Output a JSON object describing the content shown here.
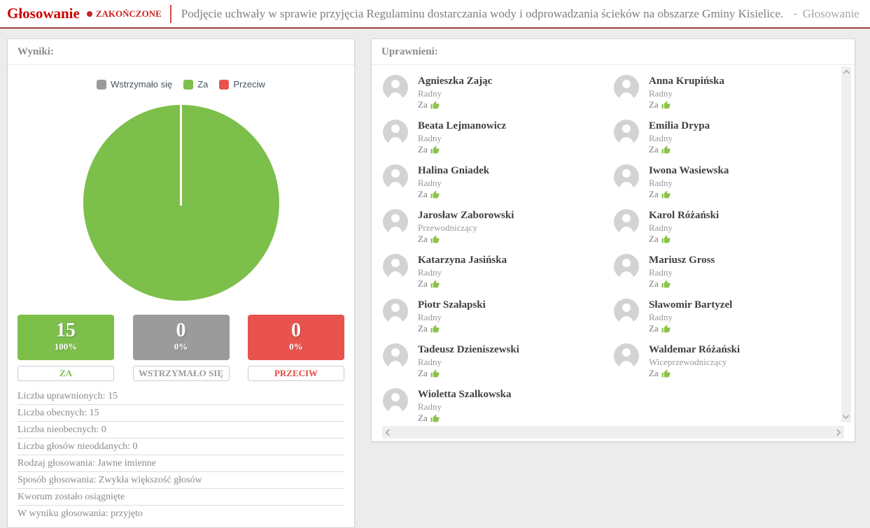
{
  "header": {
    "app_title": "Głosowanie",
    "status": "ZAKOŃCZONE",
    "doc_title": "Podjęcie uchwały w sprawie przyjęcia Regulaminu dostarczania wody i odprowadzania ścieków na obszarze Gminy Kisielice.",
    "crumb_dash": "-",
    "breadcrumb": "Głosowanie"
  },
  "chart_data": {
    "type": "pie",
    "labels": [
      "Wstrzymało się",
      "Za",
      "Przeciw"
    ],
    "values": [
      0,
      15,
      0
    ],
    "percentages": [
      0,
      100,
      0
    ],
    "colors": [
      "#9b9b9b",
      "#7cbf4a",
      "#e8534e"
    ],
    "legend_position": "top"
  },
  "results": {
    "panel_title": "Wyniki:",
    "legend": [
      {
        "label": "Wstrzymało się",
        "color": "#9b9b9b"
      },
      {
        "label": "Za",
        "color": "#7cbf4a"
      },
      {
        "label": "Przeciw",
        "color": "#e8534e"
      }
    ],
    "boxes": [
      {
        "count": "15",
        "percent": "100%",
        "label": "ZA",
        "color": "#7cbf4a"
      },
      {
        "count": "0",
        "percent": "0%",
        "label": "WSTRZYMAŁO SIĘ",
        "color": "#9b9b9b"
      },
      {
        "count": "0",
        "percent": "0%",
        "label": "PRZECIW",
        "color": "#e8534e"
      }
    ],
    "stats": [
      "Liczba uprawnionych: 15",
      "Liczba obecnych: 15",
      "Liczba nieobecnych: 0",
      "Liczba głosów nieoddanych: 0",
      "Rodzaj głosowania: Jawne imienne",
      "Sposób głosowania: Zwykła większość głosów",
      "Kworum zostało osiągnięte",
      "W wyniku głosowania: przyjęto"
    ]
  },
  "members": {
    "panel_title": "Uprawnieni:",
    "items": [
      {
        "name": "Agnieszka Zając",
        "role": "Radny",
        "vote": "Za"
      },
      {
        "name": "Anna Krupińska",
        "role": "Radny",
        "vote": "Za"
      },
      {
        "name": "Beata Lejmanowicz",
        "role": "Radny",
        "vote": "Za"
      },
      {
        "name": "Emilia Drypa",
        "role": "Radny",
        "vote": "Za"
      },
      {
        "name": "Halina Gniadek",
        "role": "Radny",
        "vote": "Za"
      },
      {
        "name": "Iwona Wasiewska",
        "role": "Radny",
        "vote": "Za"
      },
      {
        "name": "Jarosław Zaborowski",
        "role": "Przewodniczący",
        "vote": "Za"
      },
      {
        "name": "Karol Różański",
        "role": "Radny",
        "vote": "Za"
      },
      {
        "name": "Katarzyna Jasińska",
        "role": "Radny",
        "vote": "Za"
      },
      {
        "name": "Mariusz Gross",
        "role": "Radny",
        "vote": "Za"
      },
      {
        "name": "Piotr Szałapski",
        "role": "Radny",
        "vote": "Za"
      },
      {
        "name": "Sławomir Bartyzel",
        "role": "Radny",
        "vote": "Za"
      },
      {
        "name": "Tadeusz Dzieniszewski",
        "role": "Radny",
        "vote": "Za"
      },
      {
        "name": "Waldemar Różański",
        "role": "Wiceprzewodniczący",
        "vote": "Za"
      },
      {
        "name": "Wioletta Szalkowska",
        "role": "Radny",
        "vote": "Za"
      }
    ]
  }
}
